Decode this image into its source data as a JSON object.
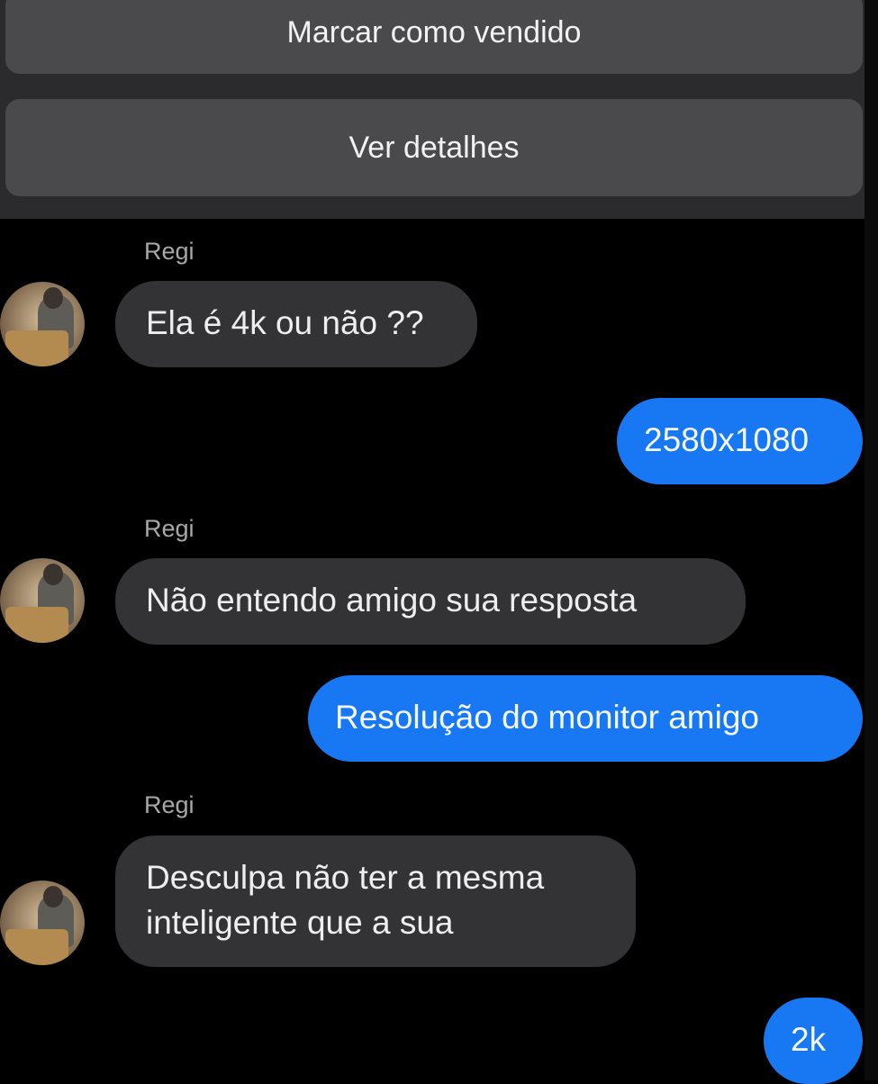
{
  "actions": {
    "mark_sold": "Marcar como vendido",
    "view_details": "Ver detalhes"
  },
  "contact": {
    "name": "Regi"
  },
  "messages": [
    {
      "from": "contact",
      "sender": "Regi",
      "text": "Ela é 4k ou não ??"
    },
    {
      "from": "me",
      "text": "2580x1080"
    },
    {
      "from": "contact",
      "sender": "Regi",
      "text": "Não entendo amigo sua resposta"
    },
    {
      "from": "me",
      "text": "Resolução do monitor amigo"
    },
    {
      "from": "contact",
      "sender": "Regi",
      "text_line1": "Desculpa não ter a mesma",
      "text_line2": "inteligente que a sua"
    },
    {
      "from": "me",
      "text": "2k"
    }
  ],
  "colors": {
    "background": "#000000",
    "panel": "#2b2b2d",
    "button": "#4a4a4c",
    "incoming_bubble": "#333336",
    "outgoing_bubble": "#1877f2"
  }
}
